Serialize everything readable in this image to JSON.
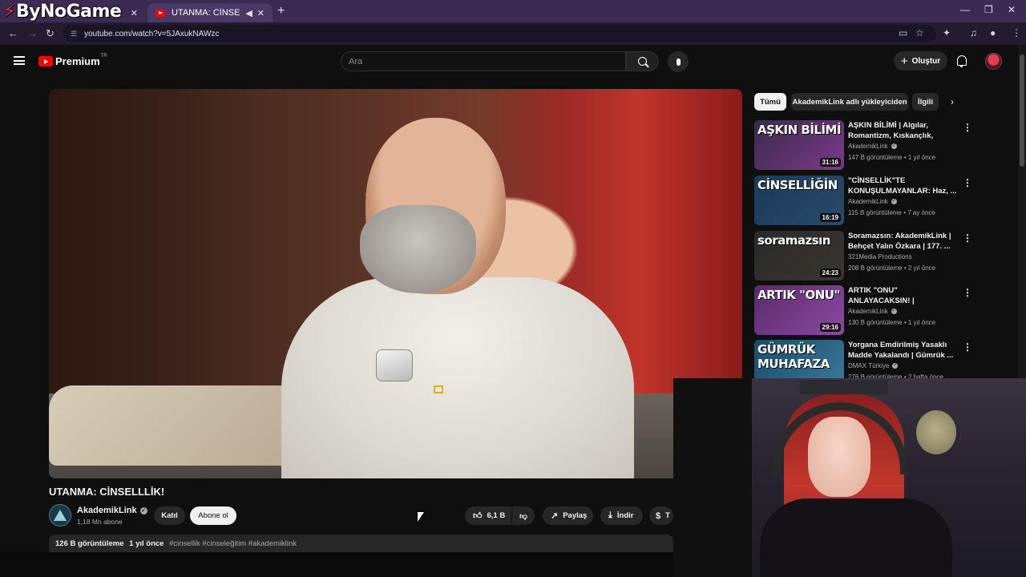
{
  "browser": {
    "watermark": "ByNoGame",
    "tabs": [
      {
        "title": "",
        "active": false
      },
      {
        "title": "UTANMA: CİNSELLLİK! - YouTube",
        "active": true
      }
    ],
    "url": "youtube.com/watch?v=5JAxukNAWzc"
  },
  "header": {
    "logo_word": "Premium",
    "country_code": "TR",
    "search_placeholder": "Ara",
    "create_label": "Oluştur"
  },
  "video": {
    "title": "UTANMA: CİNSELLLİK!",
    "channel": "AkademikLink",
    "subscribers": "1,18 Mn abone",
    "join_label": "Katıl",
    "subscribe_label": "Abone ol",
    "likes": "6,1 B",
    "share_label": "Paylaş",
    "download_label": "İndir",
    "thanks_label": "T",
    "views": "126 B görüntüleme",
    "age": "1 yıl önce",
    "hashtags": "#cinsellik #cinseleğitim #akademiklink"
  },
  "chips": [
    {
      "label": "Tümü",
      "active": true
    },
    {
      "label": "AkademikLink adlı yükleyiciden",
      "active": false
    },
    {
      "label": "İlgili",
      "active": false
    }
  ],
  "recommendations": [
    {
      "thumb_text": "AŞKIN  BİLİMİ",
      "thumb_colors": [
        "#3a2a4a",
        "#7a3a8a"
      ],
      "duration": "31:16",
      "title": "AŞKIN BİLİMİ | Algılar, Romantizm, Kıskançlık, Dürtüler",
      "channel": "AkademikLink",
      "verified": true,
      "meta": "147 B görüntüleme • 1 yıl önce"
    },
    {
      "thumb_text": "CİNSELLİĞİN",
      "thumb_colors": [
        "#1a3a5a",
        "#2a4a6a"
      ],
      "duration": "16:19",
      "title": "\"CİNSELLİK\"TE KONUŞULMAYANLAR: Haz, ...",
      "channel": "AkademikLink",
      "verified": true,
      "meta": "115 B görüntüleme • 7 ay önce"
    },
    {
      "thumb_text": "soramazsın",
      "thumb_colors": [
        "#2a2a2a",
        "#3a3530"
      ],
      "duration": "24:23",
      "title": "Soramazsın: AkademikLink | Behçet Yalın Özkara | 177. ...",
      "channel": "321Media Productions",
      "verified": false,
      "meta": "208 B görüntüleme • 2 yıl önce"
    },
    {
      "thumb_text": "ARTIK \"ONU\"",
      "thumb_colors": [
        "#5a2a6a",
        "#8a4aa0"
      ],
      "duration": "29:16",
      "title": "ARTIK \"ONU\" ANLAYACAKSIN! | Cinsiyetlerin Bilimsel Gerçekleri",
      "channel": "AkademikLink",
      "verified": true,
      "meta": "130 B görüntüleme • 1 yıl önce"
    },
    {
      "thumb_text": "GÜMRÜK MUHAFAZA",
      "thumb_colors": [
        "#1a4a6a",
        "#3a7a9a"
      ],
      "duration": "",
      "title": "Yorgana Emdirilmiş Yasaklı Madde Yakalandı | Gümrük ...",
      "channel": "DMAX Türkiye",
      "verified": true,
      "meta": "276 B görüntüleme • 2 hafta önce"
    }
  ]
}
